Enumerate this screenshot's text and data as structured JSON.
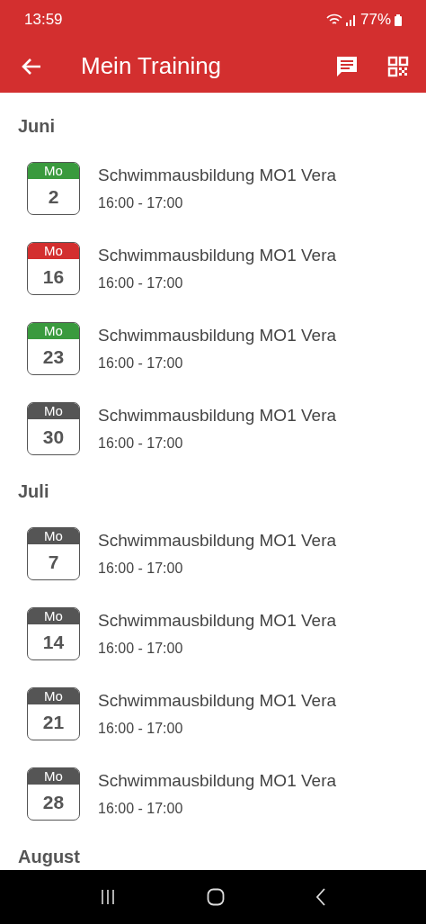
{
  "status_bar": {
    "time": "13:59",
    "battery": "77%"
  },
  "app_bar": {
    "title": "Mein Training"
  },
  "sections": [
    {
      "month": "Juni",
      "events": [
        {
          "weekday": "Mo",
          "day": "2",
          "title": "Schwimmausbildung MO1 Vera",
          "time": "16:00 - 17:00",
          "color": "#3a9a3e"
        },
        {
          "weekday": "Mo",
          "day": "16",
          "title": "Schwimmausbildung MO1 Vera",
          "time": "16:00 - 17:00",
          "color": "#d32f2f"
        },
        {
          "weekday": "Mo",
          "day": "23",
          "title": "Schwimmausbildung MO1 Vera",
          "time": "16:00 - 17:00",
          "color": "#3a9a3e"
        },
        {
          "weekday": "Mo",
          "day": "30",
          "title": "Schwimmausbildung MO1 Vera",
          "time": "16:00 - 17:00",
          "color": "#555555"
        }
      ]
    },
    {
      "month": "Juli",
      "events": [
        {
          "weekday": "Mo",
          "day": "7",
          "title": "Schwimmausbildung MO1 Vera",
          "time": "16:00 - 17:00",
          "color": "#555555"
        },
        {
          "weekday": "Mo",
          "day": "14",
          "title": "Schwimmausbildung MO1 Vera",
          "time": "16:00 - 17:00",
          "color": "#555555"
        },
        {
          "weekday": "Mo",
          "day": "21",
          "title": "Schwimmausbildung MO1 Vera",
          "time": "16:00 - 17:00",
          "color": "#555555"
        },
        {
          "weekday": "Mo",
          "day": "28",
          "title": "Schwimmausbildung MO1 Vera",
          "time": "16:00 - 17:00",
          "color": "#555555"
        }
      ]
    },
    {
      "month": "August"
    }
  ]
}
